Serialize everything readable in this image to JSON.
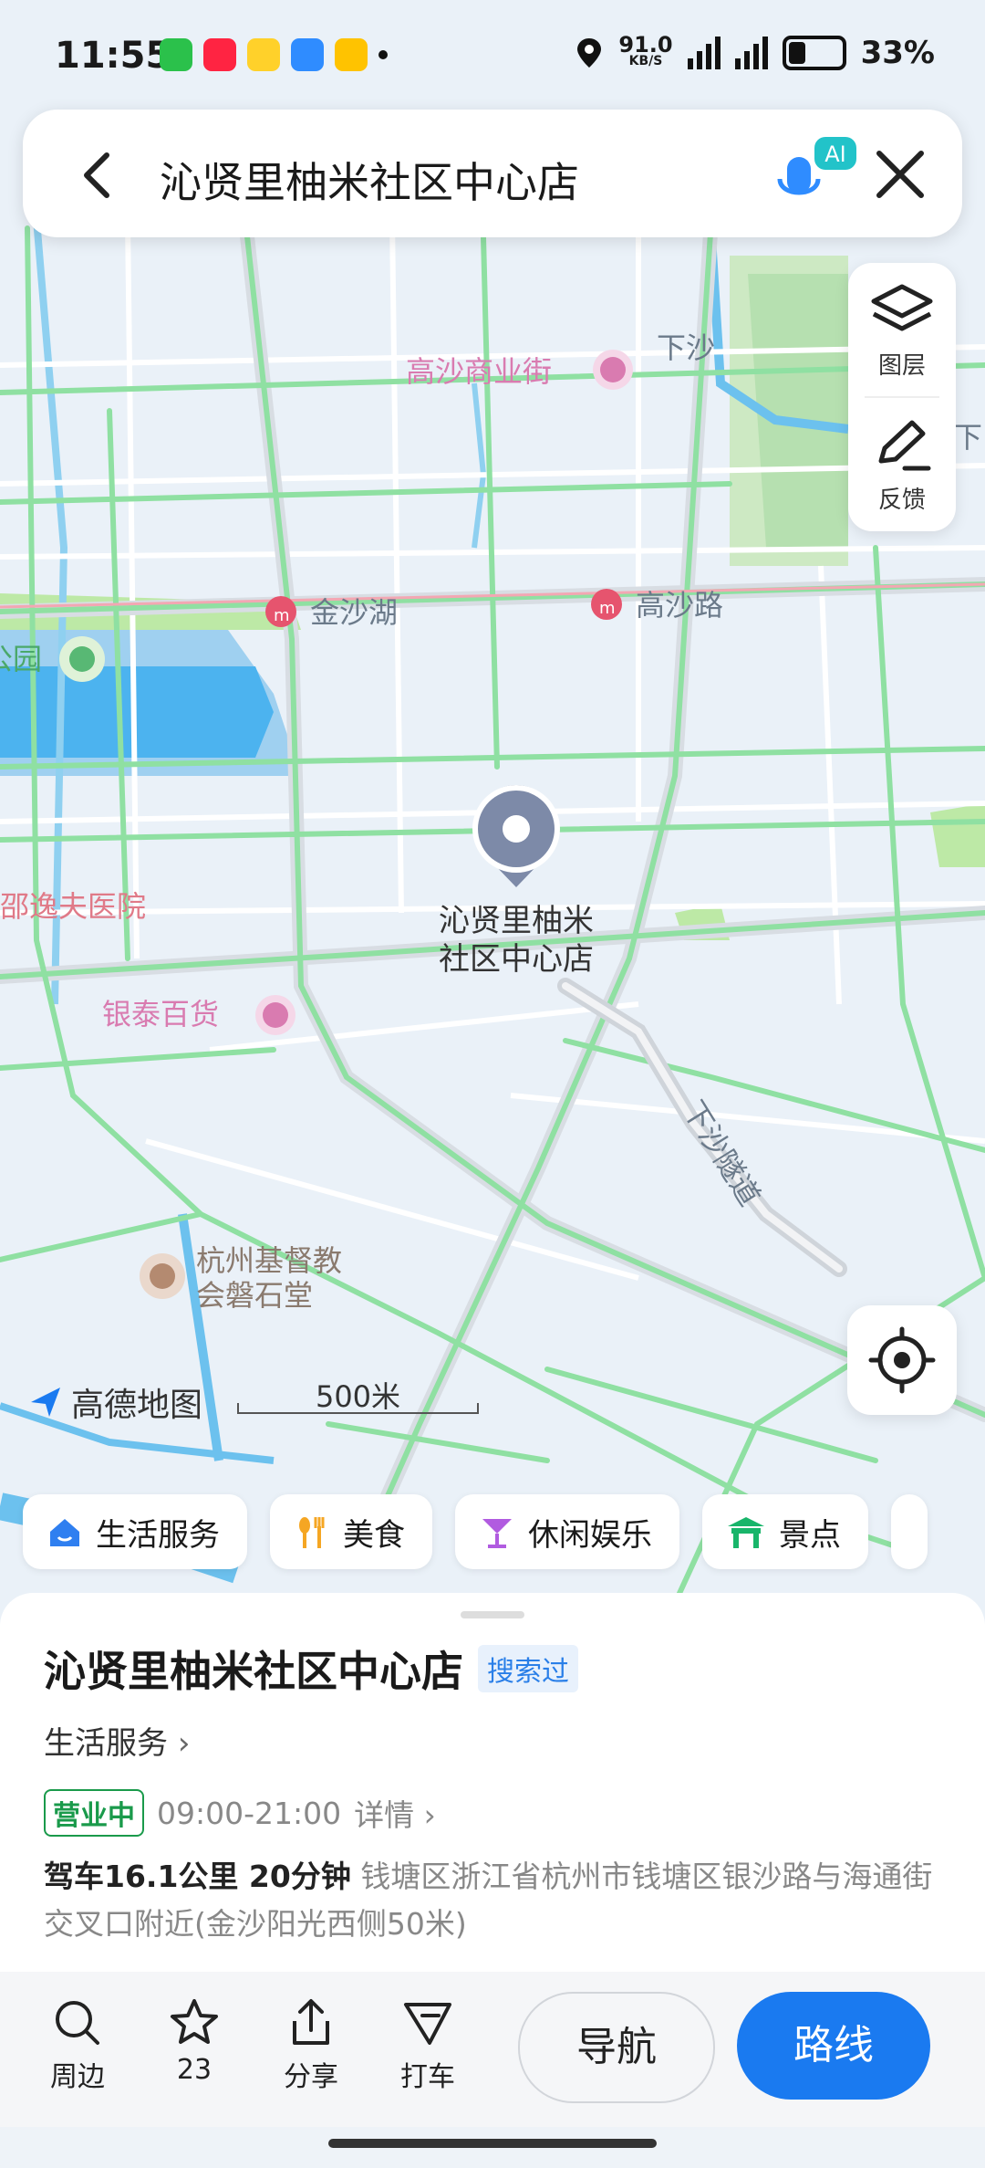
{
  "status_bar": {
    "time": "11:55",
    "net_speed": "91.0",
    "net_unit": "KB/S",
    "battery": "33%"
  },
  "search": {
    "query": "沁贤里柚米社区中心店",
    "ai_label": "AI"
  },
  "map_controls": {
    "layers_label": "图层",
    "feedback_label": "反馈"
  },
  "map": {
    "pin_label_line1": "沁贤里柚米",
    "pin_label_line2": "社区中心店",
    "labels": {
      "gaosha_street": "高沙商业街",
      "xiasha": "下沙",
      "jinshahu": "金沙湖",
      "gaosha_road": "高沙路",
      "park": "公园",
      "hospital": "邵逸夫医院",
      "yintai": "银泰百货",
      "tunnel": "下沙隧道",
      "church_line1": "杭州基督教",
      "church_line2": "会磐石堂",
      "xia_right": "下"
    },
    "brand": "高德地图",
    "scale": "500米"
  },
  "categories": [
    {
      "label": "生活服务",
      "icon": "house-icon"
    },
    {
      "label": "美食",
      "icon": "fork-spoon-icon"
    },
    {
      "label": "休闲娱乐",
      "icon": "cocktail-icon"
    },
    {
      "label": "景点",
      "icon": "pavilion-icon"
    }
  ],
  "place": {
    "name": "沁贤里柚米社区中心店",
    "searched_badge": "搜索过",
    "category": "生活服务",
    "status": "营业中",
    "hours": "09:00-21:00",
    "detail_link": "详情",
    "drive": "驾车16.1公里 20分钟",
    "address": "钱塘区浙江省杭州市钱塘区银沙路与海通街交叉口附近(金沙阳光西侧50米)"
  },
  "bottom_bar": {
    "nearby": "周边",
    "favorites": "23",
    "share": "分享",
    "taxi": "打车",
    "navigate": "导航",
    "route": "路线"
  },
  "colors": {
    "accent": "#1a7af0",
    "road_green": "#7fdb94",
    "open_green": "#1a9a4b",
    "metro_pink": "#e6546e"
  }
}
